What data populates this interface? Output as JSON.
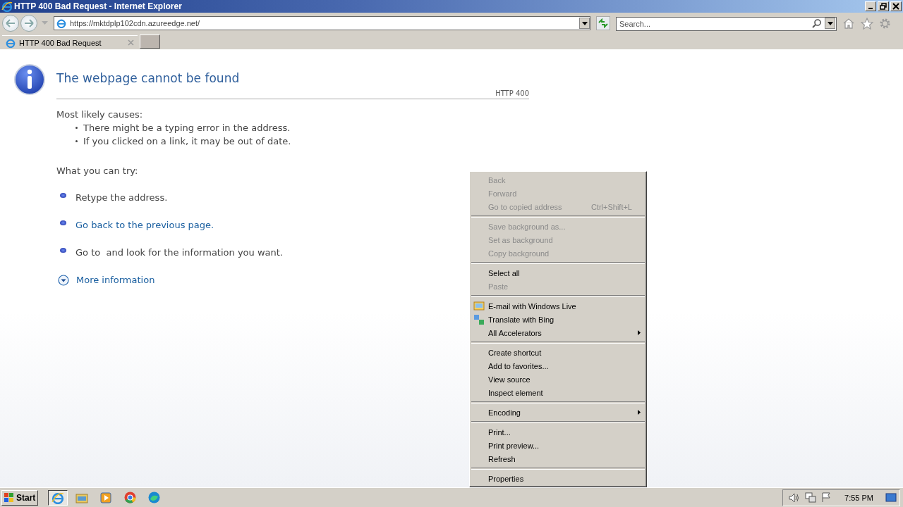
{
  "window": {
    "title": "HTTP 400 Bad Request - Internet Explorer"
  },
  "address_bar": {
    "url": "https://mktdplp102cdn.azureedge.net/"
  },
  "search": {
    "placeholder": "Search..."
  },
  "tabs": [
    {
      "label": "HTTP 400 Bad Request",
      "selected": true
    }
  ],
  "page": {
    "heading": "The webpage cannot be found",
    "code": "HTTP 400",
    "causes_title": "Most likely causes:",
    "causes": [
      "There might be a typing error in the address.",
      "If you clicked on a link, it may be out of date."
    ],
    "try_title": "What you can try:",
    "tries": [
      {
        "text": "Retype the address.",
        "kind": "text"
      },
      {
        "text": "Go back to the previous page.",
        "kind": "link"
      },
      {
        "text": "Go to  and look for the information you want.",
        "kind": "text"
      }
    ],
    "more": "More information"
  },
  "context_menu": [
    [
      {
        "label": "Back",
        "disabled": true,
        "submenu": false,
        "kind": "plain"
      },
      {
        "label": "Forward",
        "disabled": true,
        "submenu": false,
        "kind": "plain"
      },
      {
        "label": "Go to copied address",
        "shortcut": "Ctrl+Shift+L",
        "disabled": true,
        "submenu": false,
        "kind": "plain"
      }
    ],
    [
      {
        "label": "Save background as...",
        "disabled": true,
        "submenu": false,
        "kind": "plain"
      },
      {
        "label": "Set as background",
        "disabled": true,
        "submenu": false,
        "kind": "plain"
      },
      {
        "label": "Copy background",
        "disabled": true,
        "submenu": false,
        "kind": "plain"
      }
    ],
    [
      {
        "label": "Select all",
        "disabled": false,
        "submenu": false,
        "kind": "plain"
      },
      {
        "label": "Paste",
        "disabled": true,
        "submenu": false,
        "kind": "plain"
      }
    ],
    [
      {
        "label": "E-mail with Windows Live",
        "disabled": false,
        "submenu": false,
        "kind": "mail"
      },
      {
        "label": "Translate with Bing",
        "disabled": false,
        "submenu": false,
        "kind": "translate"
      },
      {
        "label": "All Accelerators",
        "disabled": false,
        "submenu": true,
        "kind": "plain"
      }
    ],
    [
      {
        "label": "Create shortcut",
        "disabled": false,
        "submenu": false,
        "kind": "plain"
      },
      {
        "label": "Add to favorites...",
        "disabled": false,
        "submenu": false,
        "kind": "plain"
      },
      {
        "label": "View source",
        "disabled": false,
        "submenu": false,
        "kind": "plain"
      },
      {
        "label": "Inspect element",
        "disabled": false,
        "submenu": false,
        "kind": "plain"
      }
    ],
    [
      {
        "label": "Encoding",
        "disabled": false,
        "submenu": true,
        "kind": "plain"
      }
    ],
    [
      {
        "label": "Print...",
        "disabled": false,
        "submenu": false,
        "kind": "plain"
      },
      {
        "label": "Print preview...",
        "disabled": false,
        "submenu": false,
        "kind": "plain"
      },
      {
        "label": "Refresh",
        "disabled": false,
        "submenu": false,
        "kind": "plain"
      }
    ],
    [
      {
        "label": "Properties",
        "disabled": false,
        "submenu": false,
        "kind": "plain"
      }
    ]
  ],
  "taskbar": {
    "start": "Start",
    "apps": [
      {
        "kind": "ie",
        "selected": true
      },
      {
        "kind": "folder",
        "selected": false
      },
      {
        "kind": "media",
        "selected": false
      },
      {
        "kind": "chrome",
        "selected": false
      },
      {
        "kind": "edge",
        "selected": false
      }
    ],
    "clock": "7:55 PM"
  }
}
